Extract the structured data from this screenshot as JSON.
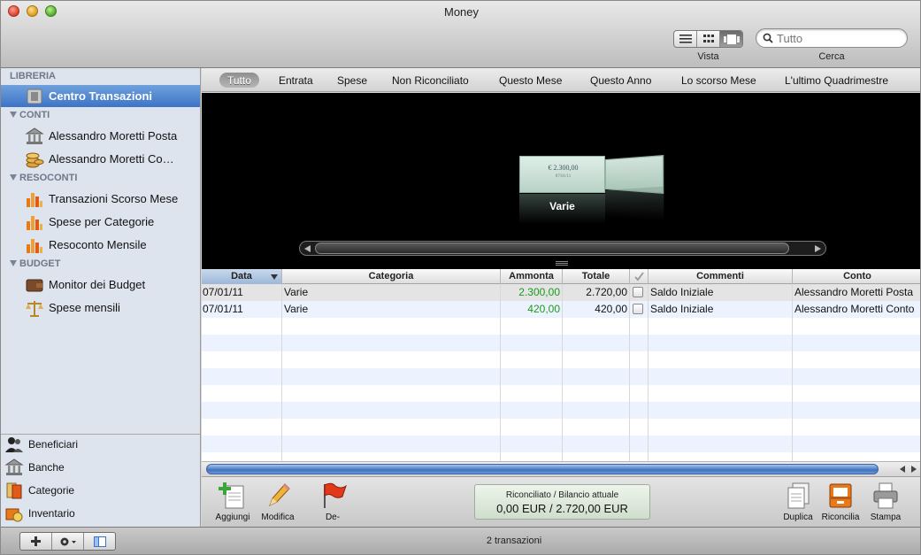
{
  "window": {
    "title": "Money"
  },
  "toolbar": {
    "view_label": "Vista",
    "search_label": "Cerca",
    "search_placeholder": "Tutto"
  },
  "sidebar": {
    "sections": {
      "libreria": "LIBRERIA",
      "conti": "CONTI",
      "resoconti": "RESOCONTI",
      "budget": "BUDGET"
    },
    "items": {
      "centro": "Centro Transazioni",
      "posta": "Alessandro Moretti Posta",
      "conto": "Alessandro Moretti Co…",
      "scorso": "Transazioni Scorso Mese",
      "categorie": "Spese per Categorie",
      "mensile": "Resoconto Mensile",
      "monitor": "Monitor dei Budget",
      "spese_mensili": "Spese mensili"
    },
    "bottom": {
      "beneficiari": "Beneficiari",
      "banche": "Banche",
      "categorie": "Categorie",
      "inventario": "Inventario"
    }
  },
  "filters": {
    "tutto": "Tutto",
    "entrata": "Entrata",
    "spese": "Spese",
    "non_riconciliato": "Non Riconciliato",
    "questo_mese": "Questo Mese",
    "questo_anno": "Questo Anno",
    "scorso_mese": "Lo scorso Mese",
    "quadrimestre": "L'ultimo Quadrimestre"
  },
  "coverflow": {
    "label": "Varie",
    "card_amount": "€ 2.300,00",
    "card_date": "07/01/11"
  },
  "table": {
    "headers": {
      "data": "Data",
      "categoria": "Categoria",
      "ammonta": "Ammonta",
      "totale": "Totale",
      "commenti": "Commenti",
      "conto": "Conto"
    },
    "rows": [
      {
        "data": "07/01/11",
        "categoria": "Varie",
        "ammonta": "2.300,00",
        "totale": "2.720,00",
        "commenti": "Saldo Iniziale",
        "conto": "Alessandro Moretti Posta"
      },
      {
        "data": "07/01/11",
        "categoria": "Varie",
        "ammonta": "420,00",
        "totale": "420,00",
        "commenti": "Saldo Iniziale",
        "conto": "Alessandro Moretti Conto"
      }
    ]
  },
  "actions": {
    "aggiungi": "Aggiungi",
    "modifica": "Modifica",
    "de": "De-",
    "duplica": "Duplica",
    "riconcilia": "Riconcilia",
    "stampa": "Stampa"
  },
  "balance": {
    "title": "Riconciliato / Bilancio attuale",
    "value": "0,00 EUR / 2.720,00 EUR"
  },
  "status": {
    "text": "2 transazioni"
  },
  "colors": {
    "selection": "#3d74c6",
    "amount_positive": "#1a9a1a"
  }
}
